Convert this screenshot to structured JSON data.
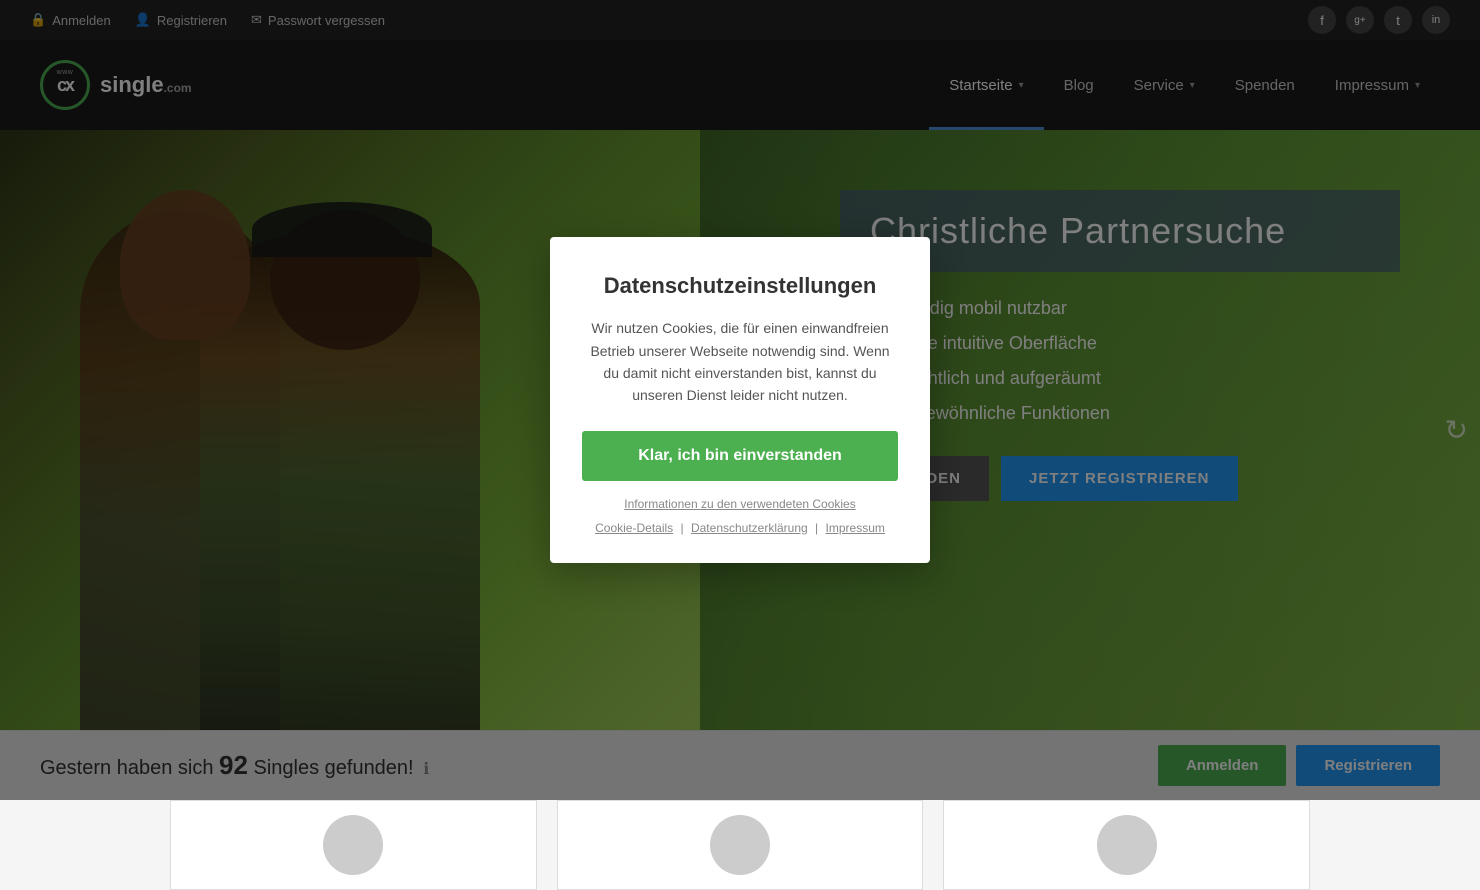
{
  "topbar": {
    "links": [
      {
        "label": "Anmelden",
        "icon": "lock-icon"
      },
      {
        "label": "Registrieren",
        "icon": "user-icon"
      },
      {
        "label": "Passwort vergessen",
        "icon": "email-icon"
      }
    ],
    "socials": [
      {
        "name": "facebook-icon",
        "symbol": "f"
      },
      {
        "name": "google-plus-icon",
        "symbol": "g+"
      },
      {
        "name": "twitter-icon",
        "symbol": "t"
      },
      {
        "name": "linkedin-icon",
        "symbol": "in"
      }
    ]
  },
  "navbar": {
    "logo": {
      "www": "www",
      "cx": "cx",
      "single": "single",
      "com": ".com"
    },
    "nav_items": [
      {
        "label": "Startseite",
        "active": true,
        "has_dropdown": true
      },
      {
        "label": "Blog",
        "active": false,
        "has_dropdown": false
      },
      {
        "label": "Service",
        "active": false,
        "has_dropdown": true
      },
      {
        "label": "Spenden",
        "active": false,
        "has_dropdown": false
      },
      {
        "label": "Impressum",
        "active": false,
        "has_dropdown": true
      }
    ]
  },
  "hero": {
    "title": "Christliche Partnersuche",
    "features": [
      "Vollständig mobil nutzbar",
      "Moderne intuitive Oberfläche",
      "Übersichtlich und aufgeräumt",
      "Außergewöhnliche Funktionen"
    ],
    "btn_login": "ANMELDEN",
    "btn_register": "JETZT REGISTRIEREN"
  },
  "bottom_bar": {
    "prefix": "Gestern haben sich",
    "count": "92",
    "suffix": "Singles gefunden!",
    "btn_anmelden": "Anmelden",
    "btn_registrieren": "Registrieren"
  },
  "modal": {
    "title": "Datenschutzeinstellungen",
    "body": "Wir nutzen Cookies, die für einen einwandfreien Betrieb unserer Webseite notwendig sind. Wenn du damit nicht einverstanden bist, kannst du unseren Dienst leider nicht nutzen.",
    "btn_accept": "Klar, ich bin einverstanden",
    "info_link": "Informationen zu den verwendeten Cookies",
    "footer_links": [
      {
        "label": "Cookie-Details"
      },
      {
        "label": "Datenschutzerklärung"
      },
      {
        "label": "Impressum"
      }
    ]
  }
}
